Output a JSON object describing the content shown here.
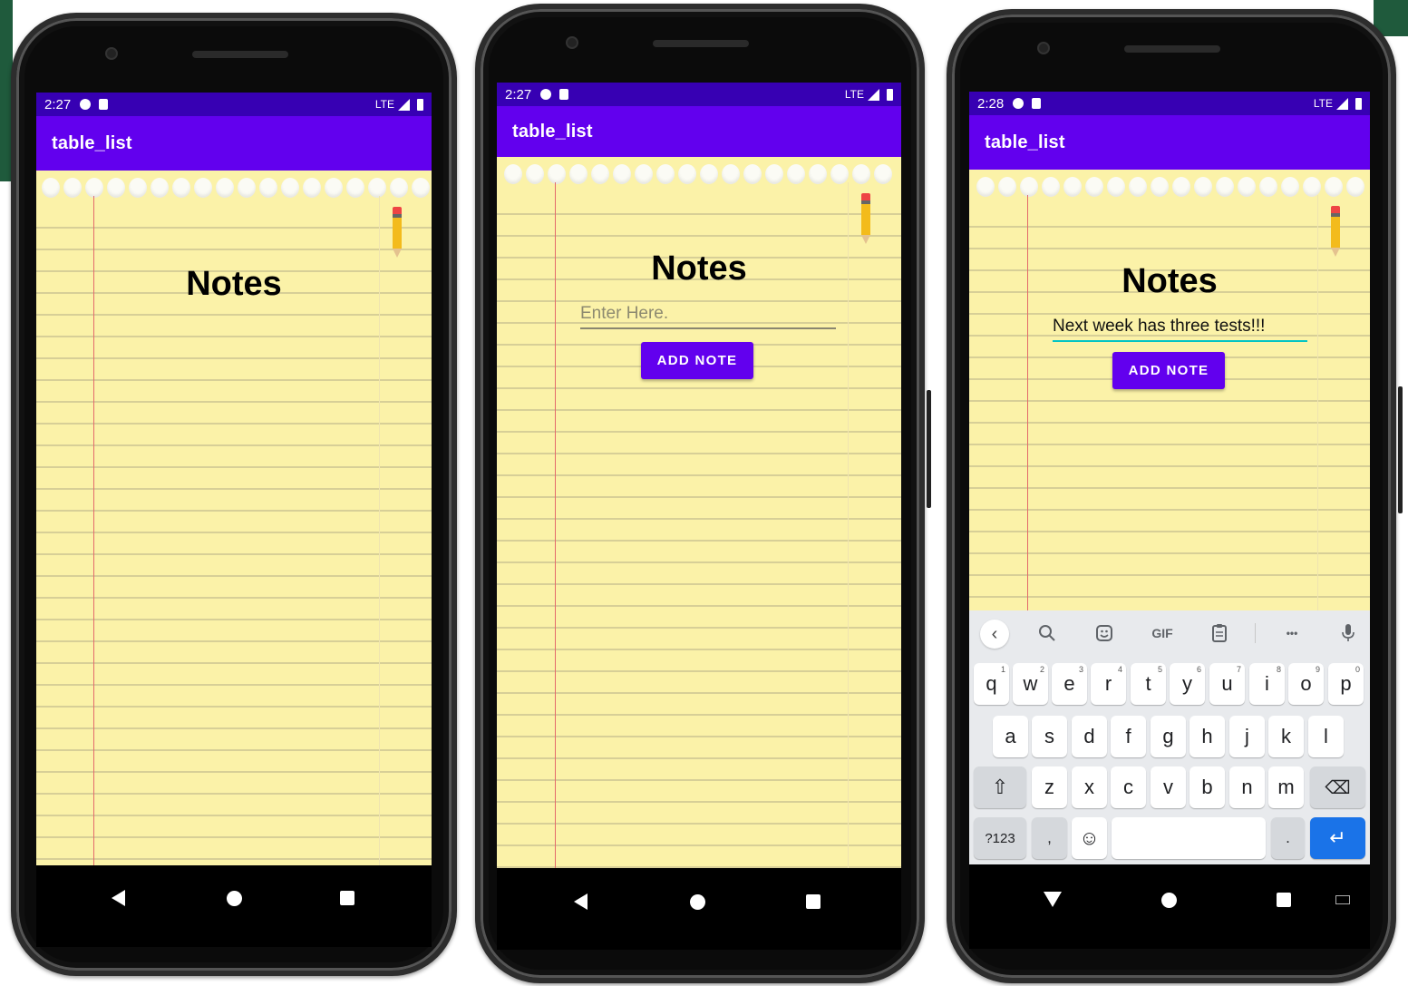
{
  "screens": [
    {
      "status_time": "2:27",
      "status_net": "LTE",
      "app_title": "table_list",
      "notes_title": "Notes"
    },
    {
      "status_time": "2:27",
      "status_net": "LTE",
      "app_title": "table_list",
      "notes_title": "Notes",
      "input_placeholder": "Enter Here.",
      "add_button": "ADD NOTE"
    },
    {
      "status_time": "2:28",
      "status_net": "LTE",
      "app_title": "table_list",
      "notes_title": "Notes",
      "input_value": "Next week has three tests!!!",
      "add_button": "ADD NOTE",
      "keyboard": {
        "toolbar": [
          "back",
          "search",
          "sticker",
          "GIF",
          "clipboard",
          "more",
          "mic"
        ],
        "gif_label": "GIF",
        "more_label": "•••",
        "row1": [
          {
            "k": "q",
            "n": "1"
          },
          {
            "k": "w",
            "n": "2"
          },
          {
            "k": "e",
            "n": "3"
          },
          {
            "k": "r",
            "n": "4"
          },
          {
            "k": "t",
            "n": "5"
          },
          {
            "k": "y",
            "n": "6"
          },
          {
            "k": "u",
            "n": "7"
          },
          {
            "k": "i",
            "n": "8"
          },
          {
            "k": "o",
            "n": "9"
          },
          {
            "k": "p",
            "n": "0"
          }
        ],
        "row2": [
          "a",
          "s",
          "d",
          "f",
          "g",
          "h",
          "j",
          "k",
          "l"
        ],
        "row3": [
          "z",
          "x",
          "c",
          "v",
          "b",
          "n",
          "m"
        ],
        "symbols_key": "?123",
        "comma_key": ",",
        "period_key": ".",
        "enter_key": "↵",
        "shift_key": "⇧",
        "backspace_key": "⌫",
        "emoji_key": "☺",
        "accent": "#1a73e8"
      }
    }
  ],
  "colors": {
    "status_bar": "#3700b3",
    "app_bar": "#6200ee",
    "button": "#6200ee",
    "paper": "#fbf2a8",
    "margin_line": "#e36b6b",
    "input_focus": "#03c4c4"
  }
}
